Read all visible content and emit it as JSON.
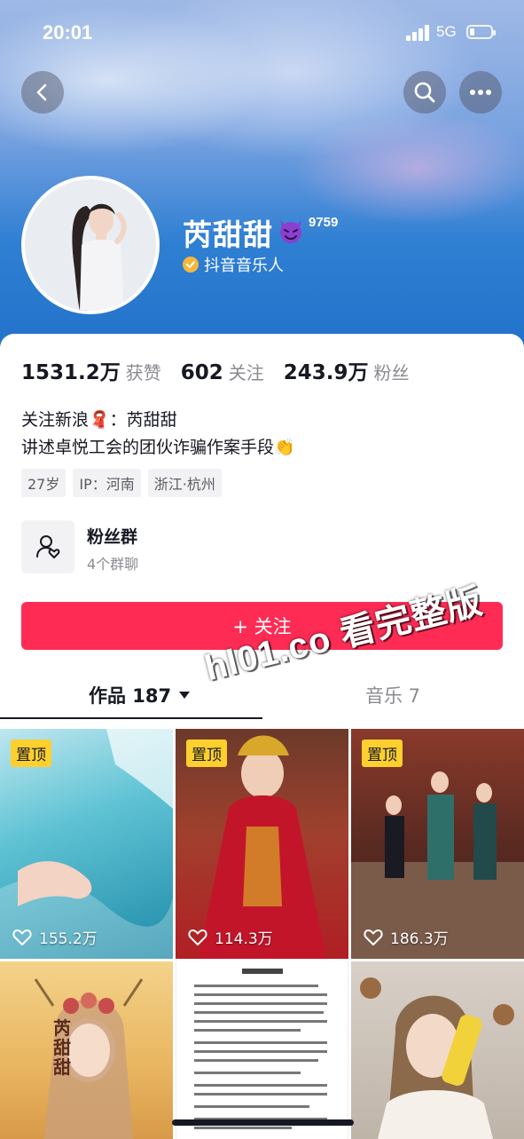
{
  "status_bar": {
    "time": "20:01",
    "network": "5G"
  },
  "profile": {
    "name": "芮甜甜",
    "level": "9759",
    "verify_label": "抖音音乐人",
    "stats": [
      {
        "value": "1531.2万",
        "label": "获赞"
      },
      {
        "value": "602",
        "label": "关注"
      },
      {
        "value": "243.9万",
        "label": "粉丝"
      }
    ],
    "bio_line1": "关注新浪🧣：芮甜甜",
    "bio_line2": "讲述卓悦工会的团伙诈骗作案手段👏",
    "tags": [
      "27岁",
      "IP：河南",
      "浙江·杭州"
    ]
  },
  "fans_group": {
    "title": "粉丝群",
    "subtitle": "4个群聊"
  },
  "follow_button": "+ 关注",
  "tabs": {
    "works": "作品 187",
    "music": "音乐 7"
  },
  "watermark": "hl01.co 看完整版",
  "videos": [
    {
      "pinned": "置顶",
      "likes": "155.2万"
    },
    {
      "pinned": "置顶",
      "likes": "114.3万"
    },
    {
      "pinned": "置顶",
      "likes": "186.3万"
    },
    {
      "poster_text": "芮甜甜"
    },
    {},
    {}
  ]
}
